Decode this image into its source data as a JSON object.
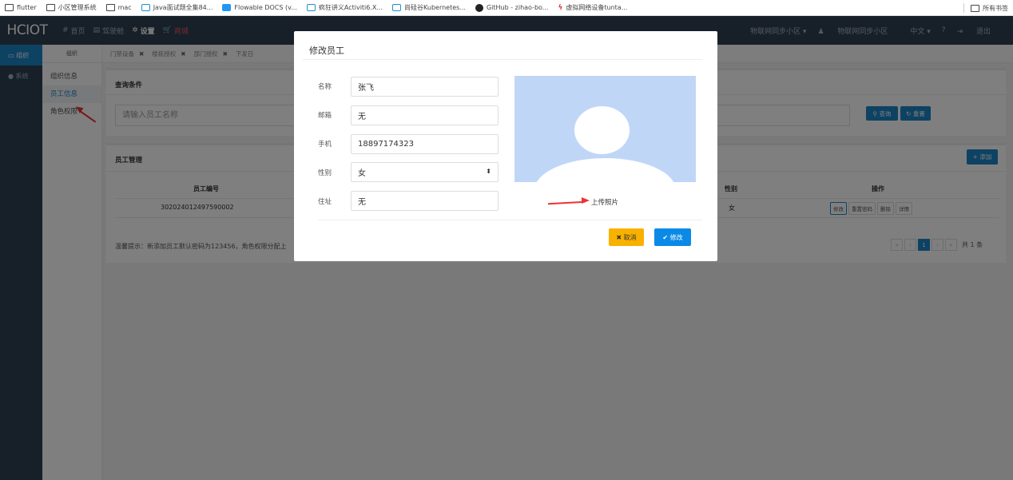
{
  "bookmarks": [
    {
      "label": "flutter",
      "icon": "folder-icon"
    },
    {
      "label": "小区管理系统",
      "icon": "folder-icon"
    },
    {
      "label": "mac",
      "icon": "folder-icon"
    },
    {
      "label": "Java面试题全集84...",
      "icon": "bilibili-icon"
    },
    {
      "label": "Flowable DOCS (v...",
      "icon": "flowable-icon"
    },
    {
      "label": "疯狂讲义Activiti6.X...",
      "icon": "bilibili-icon"
    },
    {
      "label": "尚硅谷Kubernetes...",
      "icon": "bilibili-icon"
    },
    {
      "label": "GitHub - zihao-bo...",
      "icon": "github-icon"
    },
    {
      "label": "虚拟网络设备tunta...",
      "icon": "bolt-icon"
    }
  ],
  "bookmarks_all": "所有书签",
  "nav": {
    "logo": "HCIOT",
    "items": [
      {
        "label": "首页",
        "icon": "#"
      },
      {
        "label": "驾驶舱",
        "icon": "▤"
      },
      {
        "label": "设置",
        "icon": "✲"
      },
      {
        "label": "商城",
        "icon": "🛒"
      }
    ],
    "right": {
      "community_select": "物联网同步小区 ▾",
      "user": "物联网同步小区",
      "language": "中文 ▾",
      "help": "?",
      "logout": "退出"
    }
  },
  "sidebar": {
    "items": [
      {
        "label": "组织",
        "icon": "monitor-icon"
      },
      {
        "label": "系统",
        "icon": "gear-icon"
      }
    ]
  },
  "submenu": {
    "header": "组织",
    "items": [
      "组织信息",
      "员工信息",
      "角色权限"
    ]
  },
  "tabs": [
    {
      "label": "门禁设备"
    },
    {
      "label": "楼栋授权"
    },
    {
      "label": "部门授权"
    },
    {
      "label": "下发日"
    }
  ],
  "query_panel": {
    "title": "查询条件",
    "placeholder": "请输入员工名称",
    "query_button": "查询",
    "reset_button": "重置"
  },
  "staff_panel": {
    "title": "员工管理",
    "add_button": "添加",
    "columns": {
      "id": "员工编号",
      "gender": "性别",
      "actions": "操作"
    },
    "rows": [
      {
        "id": "302024012497590002",
        "gender": "女"
      }
    ],
    "row_actions": [
      "修改",
      "重置密码",
      "删除",
      "详情"
    ],
    "tip": "温馨提示：新添加员工默认密码为123456，角色权限分配上",
    "pager": {
      "first": "«",
      "prev": "‹",
      "current": "1",
      "next": "›",
      "last": "»",
      "total": "共 1 条"
    }
  },
  "modal": {
    "title": "修改员工",
    "fields": [
      {
        "label": "名称",
        "value": "张飞"
      },
      {
        "label": "邮箱",
        "value": "无"
      },
      {
        "label": "手机",
        "value": "18897174323"
      },
      {
        "label": "性别",
        "value": "女"
      },
      {
        "label": "住址",
        "value": "无"
      }
    ],
    "upload_label": "上传照片",
    "cancel_button": "取消",
    "submit_button": "修改"
  }
}
